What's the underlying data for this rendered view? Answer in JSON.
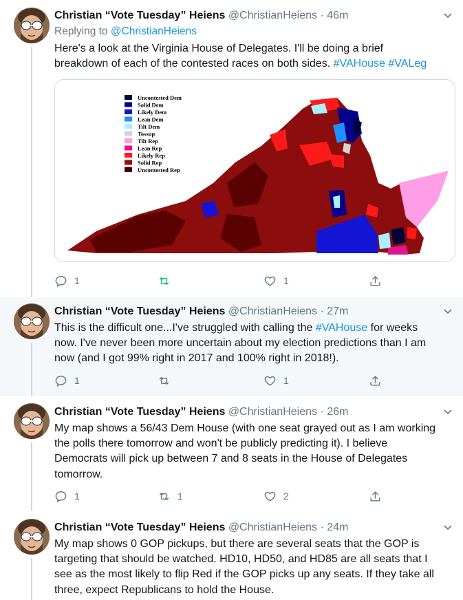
{
  "tweets": [
    {
      "display_name": "Christian “Vote Tuesday” Heiens",
      "handle": "@ChristianHeiens",
      "time": "46m",
      "replying_prefix": "Replying to",
      "replying_handle": "@ChristianHeiens",
      "text_lines": [
        "Here's a look at the Virginia House of Delegates. I'll be doing a brief",
        "breakdown of each of the contested races on both sides."
      ],
      "hashtags": [
        "#VAHouse",
        "#VALeg"
      ],
      "replies": "1",
      "retweets": "",
      "likes": "1"
    },
    {
      "display_name": "Christian “Vote Tuesday” Heiens",
      "handle": "@ChristianHeiens",
      "time": "27m",
      "text_line1_before": "This is the difficult one...I've struggled with calling the",
      "text_line1_hashtag": "#VAHouse",
      "text_line1_after": "for weeks",
      "text_lines": [
        "now. I've never been more uncertain about my election predictions than I am",
        "now (and I got 99% right in 2017 and 100% right in 2018!)."
      ],
      "replies": "1",
      "retweets": "",
      "likes": "1"
    },
    {
      "display_name": "Christian “Vote Tuesday” Heiens",
      "handle": "@ChristianHeiens",
      "time": "26m",
      "text_lines": [
        "My map shows a 56/43 Dem House (with one seat grayed out as I am working",
        "the polls there tomorrow and won't be publicly predicting it). I believe",
        "Democrats will pick up between 7 and 8 seats in the House of Delegates",
        "tomorrow."
      ],
      "replies": "1",
      "retweets": "1",
      "likes": "2"
    },
    {
      "display_name": "Christian “Vote Tuesday” Heiens",
      "handle": "@ChristianHeiens",
      "time": "24m",
      "text_lines": [
        "My map shows 0 GOP pickups, but there are several seats that the GOP is",
        "targeting that should be watched. HD10, HD50, and HD85 are all seats that I",
        "see as the most likely to flip Red if the GOP picks up any seats. If they take all",
        "three, expect Republicans to hold the House."
      ]
    }
  ],
  "map_legend": [
    {
      "label": "Uncontested Dem",
      "color": "#00003a"
    },
    {
      "label": "Solid Dem",
      "color": "#00008b"
    },
    {
      "label": "Likely Dem",
      "color": "#1515d6"
    },
    {
      "label": "Lean Dem",
      "color": "#1e90ff"
    },
    {
      "label": "Tilt Dem",
      "color": "#a8f0ff"
    },
    {
      "label": "Tossup",
      "color": "#d3d3d3"
    },
    {
      "label": "Tilt Rep",
      "color": "#ff9ee6"
    },
    {
      "label": "Lean Rep",
      "color": "#e0168f"
    },
    {
      "label": "Likely Rep",
      "color": "#ff1a1a"
    },
    {
      "label": "Solid Rep",
      "color": "#9e0b0b"
    },
    {
      "label": "Uncontested Rep",
      "color": "#4a0000"
    }
  ],
  "colors": {
    "text": "#14171a",
    "muted": "#657786",
    "link": "#1b95e0",
    "retweet_green": "#17bf63",
    "border": "#e1e8ed"
  },
  "separator": "·"
}
